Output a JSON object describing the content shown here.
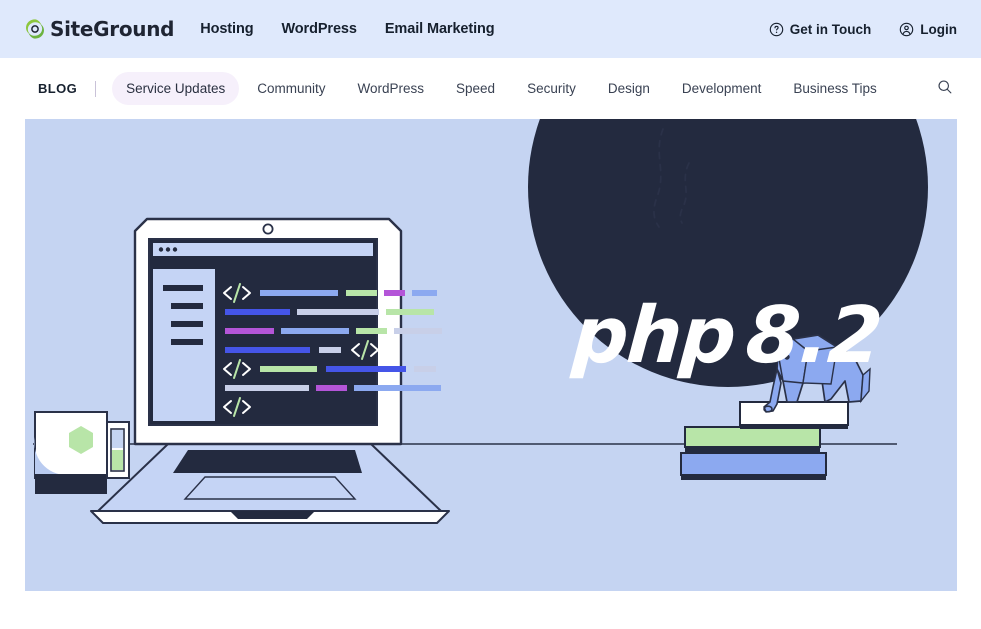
{
  "header": {
    "brand": {
      "name": "SiteGround",
      "icon": "siteground-leaf-icon"
    },
    "nav": [
      {
        "label": "Hosting"
      },
      {
        "label": "WordPress"
      },
      {
        "label": "Email Marketing"
      }
    ],
    "actions": [
      {
        "label": "Get in Touch",
        "icon": "question-circle-icon"
      },
      {
        "label": "Login",
        "icon": "user-circle-icon"
      }
    ],
    "background_color": "#dfe9fc"
  },
  "blog_nav": {
    "label": "BLOG",
    "search_icon": "search-icon",
    "active_pill_color": "#f6f0fb",
    "categories": [
      {
        "label": "Service Updates",
        "active": true
      },
      {
        "label": "Community",
        "active": false
      },
      {
        "label": "WordPress",
        "active": false
      },
      {
        "label": "Speed",
        "active": false
      },
      {
        "label": "Security",
        "active": false
      },
      {
        "label": "Design",
        "active": false
      },
      {
        "label": "Development",
        "active": false
      },
      {
        "label": "Business Tips",
        "active": false
      }
    ]
  },
  "hero": {
    "background_color": "#c5d4f2",
    "badge_color": "#232a3f",
    "title_word": "php",
    "title_version": "8.2",
    "illustration": {
      "laptop": "laptop-with-code-editor",
      "mascot": "php-elephant",
      "mug": "steaming-coffee-mug",
      "books": "stack-of-books"
    },
    "code_colors": {
      "blue": "#8ca9f0",
      "royal": "#4555e8",
      "green": "#b8e5a8",
      "purple": "#b455d8",
      "gray": "#c8cfe8",
      "editor_bg": "#232a3f",
      "sidebar": "#c5d4f5"
    }
  }
}
